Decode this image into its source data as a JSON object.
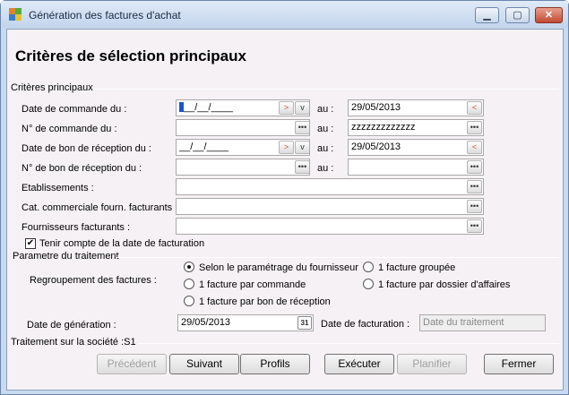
{
  "window": {
    "title": "Génération des factures d'achat",
    "minimize_icon": "minimize-icon",
    "maximize_icon": "maximize-icon",
    "close_icon": "close-icon"
  },
  "heading": "Critères de sélection principaux",
  "section_main": "Critères principaux",
  "rows": [
    {
      "label": "Date de commande du :",
      "from": "__/__/____",
      "to_label": "au :",
      "to": "29/05/2013"
    },
    {
      "label": "N° de commande du :",
      "from": "",
      "to_label": "au :",
      "to": "zzzzzzzzzzzzz"
    },
    {
      "label": "Date de bon de réception du :",
      "from": "__/__/____",
      "to_label": "au :",
      "to": "29/05/2013"
    },
    {
      "label": "N° de bon de réception du :",
      "from": "",
      "to_label": "au :",
      "to": ""
    }
  ],
  "etablissements": {
    "label": "Etablissements :",
    "value": ""
  },
  "cat_commerciale": {
    "label": "Cat. commerciale fourn. facturants :",
    "value": ""
  },
  "fournisseurs": {
    "label": "Fournisseurs facturants :",
    "value": ""
  },
  "tenir_compte": {
    "label": "Tenir compte de la date de facturation",
    "checked": true,
    "mark": "✔"
  },
  "section_param": "Parametre du traitement",
  "regroupement": {
    "label": "Regroupement des factures :",
    "options": [
      "Selon le paramétrage du fournisseur",
      "1 facture groupée",
      "1 facture par commande",
      "1 facture par dossier d'affaires",
      "1 facture par bon de réception"
    ],
    "selected": "Selon le paramétrage du fournisseur"
  },
  "date_generation": {
    "label": "Date de génération :",
    "value": "29/05/2013",
    "calendar_day": "31"
  },
  "date_facturation": {
    "label": "Date de facturation :",
    "placeholder": "Date du traitement"
  },
  "section_societe": "Traitement sur la société :S1",
  "buttons": {
    "precedent": "Précédent",
    "suivant": "Suivant",
    "profils": "Profils",
    "executer": "Exécuter",
    "planifier": "Planifier",
    "fermer": "Fermer"
  },
  "icons": {
    "ellipsis": "•••",
    "arrow": ">",
    "chevron": "v",
    "clear": "<"
  },
  "colors": {
    "title_bg": "#c9d9ee",
    "panel_bg": "#f5f1f4",
    "close_button": "#c24a33"
  }
}
